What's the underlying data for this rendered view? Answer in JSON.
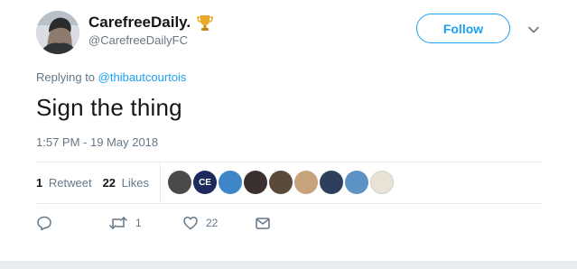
{
  "author": {
    "display_name": "CarefreeDaily.",
    "handle": "@CarefreeDailyFC",
    "badge_icon": "trophy-icon"
  },
  "header": {
    "follow_label": "Follow",
    "menu_icon": "chevron-down-icon"
  },
  "reply_context": {
    "prefix": "Replying to",
    "mention": "@thibautcourtois"
  },
  "tweet": {
    "text": "Sign the thing",
    "timestamp": "1:57 PM - 19 May 2018"
  },
  "stats": {
    "retweets_count": "1",
    "retweets_label": "Retweet",
    "likes_count": "22",
    "likes_label": "Likes"
  },
  "likers": [
    {
      "initials": "",
      "color": "#4a4a4a"
    },
    {
      "initials": "CE",
      "color": "#1c2a5c"
    },
    {
      "initials": "",
      "color": "#3f86c9"
    },
    {
      "initials": "",
      "color": "#3a3030"
    },
    {
      "initials": "",
      "color": "#5a4a3a"
    },
    {
      "initials": "",
      "color": "#c8a27a"
    },
    {
      "initials": "",
      "color": "#2e3f5e"
    },
    {
      "initials": "",
      "color": "#5c93c4"
    },
    {
      "initials": "",
      "color": "#e9e2d5"
    }
  ],
  "actions": {
    "reply_count": "",
    "retweet_count": "1",
    "like_count": "22"
  },
  "colors": {
    "accent": "#1da1f2",
    "secondary_text": "#657786",
    "primary_text": "#14171a",
    "divider": "#e6ecf0"
  }
}
